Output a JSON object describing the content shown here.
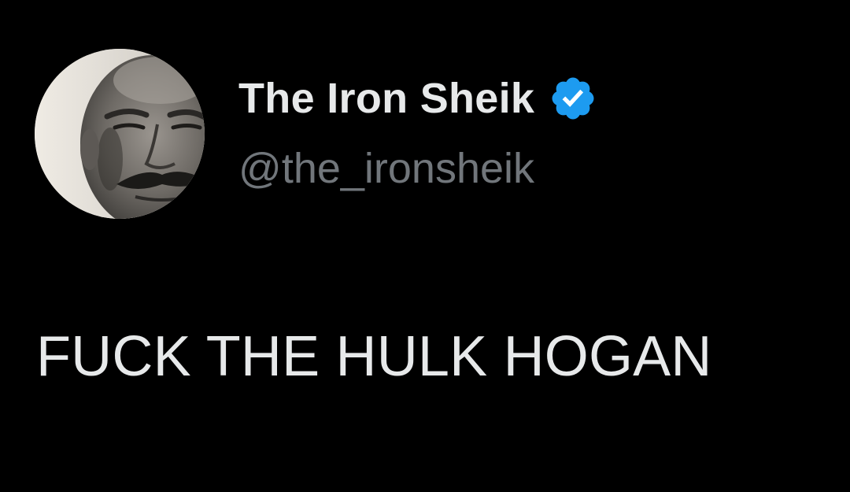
{
  "tweet": {
    "author": {
      "display_name": "The Iron Sheik",
      "handle": "@the_ironsheik",
      "verified": true,
      "avatar_icon": "profile-photo",
      "verified_icon": "verified-badge-icon"
    },
    "text": "FUCK THE HULK HOGAN"
  },
  "colors": {
    "background": "#000000",
    "primary_text": "#e7e9ea",
    "secondary_text": "#71767b",
    "verified_blue": "#1d9bf0"
  }
}
